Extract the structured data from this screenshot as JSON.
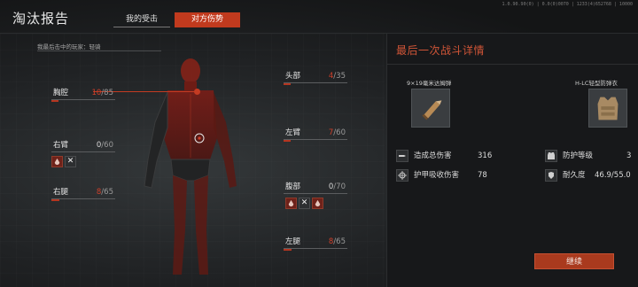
{
  "header": {
    "title": "淘汰报告",
    "tabs": [
      {
        "label": "我的受击",
        "active": false
      },
      {
        "label": "对方伤势",
        "active": true
      }
    ],
    "version": "1.0.90.90(0) | 0.0(0)0070 | 1233(4)652768 | 10000"
  },
  "killer": {
    "label": "我最后击中的玩家：轻骑"
  },
  "body_parts": [
    {
      "name": "胸腔",
      "current": "10",
      "max": "85",
      "ratio": 0.118
    },
    {
      "name": "头部",
      "current": "4",
      "max": "35",
      "ratio": 0.114
    },
    {
      "name": "右臂",
      "current": "0",
      "max": "60",
      "ratio": 0.0
    },
    {
      "name": "左臂",
      "current": "7",
      "max": "60",
      "ratio": 0.117
    },
    {
      "name": "右腿",
      "current": "8",
      "max": "65",
      "ratio": 0.123
    },
    {
      "name": "腹部",
      "current": "0",
      "max": "70",
      "ratio": 0.0
    },
    {
      "name": "左腿",
      "current": "8",
      "max": "65",
      "ratio": 0.123
    }
  ],
  "last_battle": {
    "title": "最后一次战斗详情",
    "weapon_name": "9×19毫米达姆弹",
    "armor_name": "H-LC轻型防弹衣",
    "stats": {
      "total_damage_label": "造成总伤害",
      "total_damage_value": "316",
      "armor_absorbed_label": "护甲吸收伤害",
      "armor_absorbed_value": "78",
      "protection_level_label": "防护等级",
      "protection_level_value": "3",
      "durability_label": "耐久度",
      "durability_value": "46.9/55.0"
    }
  },
  "continue_label": "继续",
  "colors": {
    "accent": "#c13a1e",
    "damage_red": "#d0402a"
  }
}
